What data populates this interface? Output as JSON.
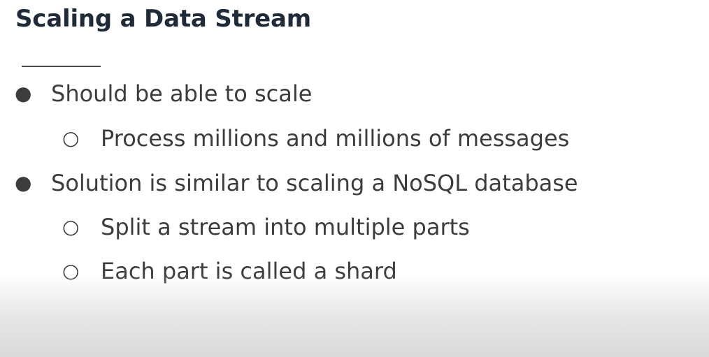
{
  "slide": {
    "title": "Scaling a Data Stream",
    "bullets": [
      {
        "level": 1,
        "marker": "●",
        "text": "Should be able to scale"
      },
      {
        "level": 2,
        "marker": "○",
        "text": "Process millions and millions of messages"
      },
      {
        "level": 1,
        "marker": "●",
        "text": "Solution is similar to scaling a NoSQL database"
      },
      {
        "level": 2,
        "marker": "○",
        "text": "Split a stream into multiple parts"
      },
      {
        "level": 2,
        "marker": "○",
        "text": "Each part is called a shard"
      }
    ]
  }
}
